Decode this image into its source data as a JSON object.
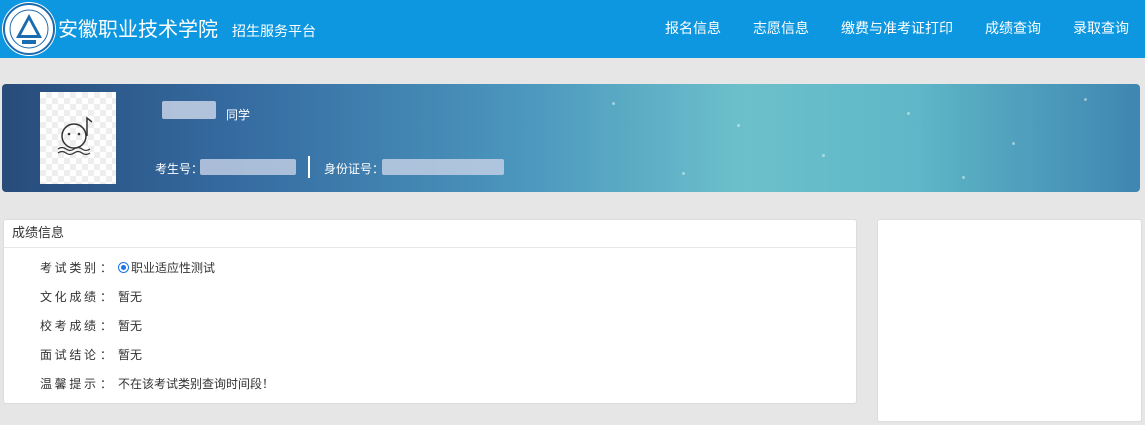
{
  "header": {
    "school_name": "安徽职业技术学院",
    "platform_name": "招生服务平台",
    "nav": [
      {
        "label": "报名信息"
      },
      {
        "label": "志愿信息"
      },
      {
        "label": "缴费与准考证打印"
      },
      {
        "label": "成绩查询"
      },
      {
        "label": "录取查询"
      }
    ],
    "colors": {
      "bar": "#0d97e0"
    }
  },
  "banner": {
    "name_suffix": "同学",
    "exam_no_label": "考生号：",
    "id_label": "身份证号："
  },
  "score": {
    "title": "成绩信息",
    "rows": [
      {
        "label": "考试类别",
        "colon": "：",
        "value": "职业适应性测试",
        "radio": true
      },
      {
        "label": "文化成绩",
        "colon": "：",
        "value": "暂无"
      },
      {
        "label": "校考成绩",
        "colon": "：",
        "value": "暂无"
      },
      {
        "label": "面试结论",
        "colon": "：",
        "value": "暂无"
      },
      {
        "label": "温馨提示",
        "colon": "：",
        "value": "不在该考试类别查询时间段！"
      }
    ]
  }
}
